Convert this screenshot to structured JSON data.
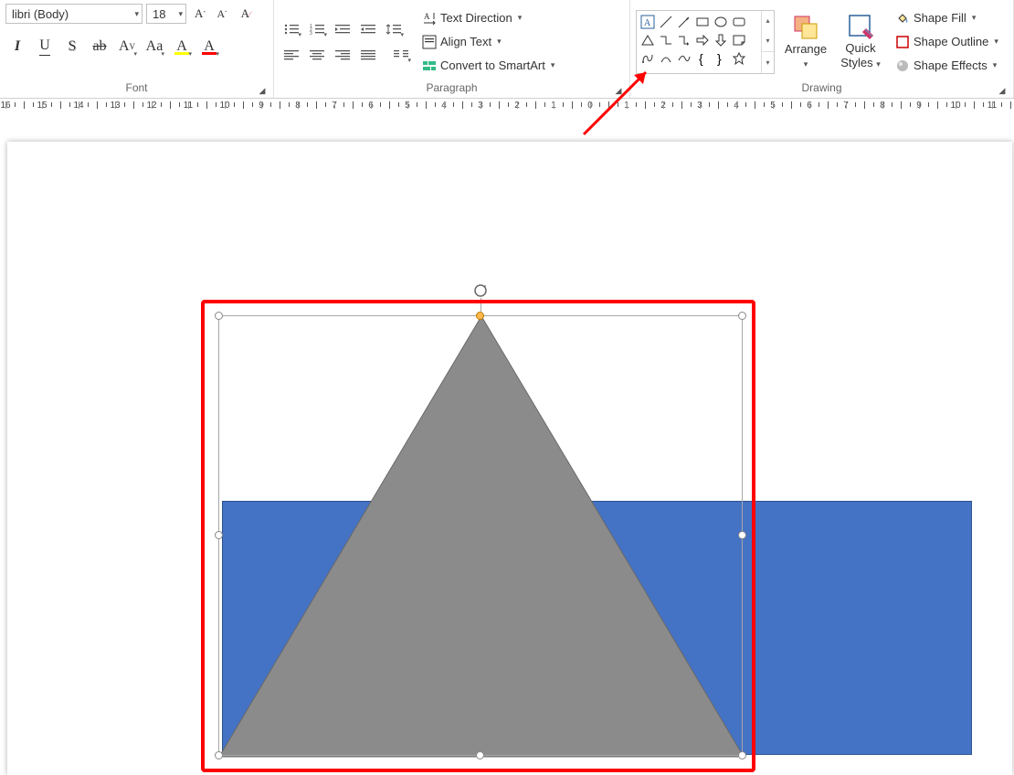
{
  "font": {
    "name": "libri (Body)",
    "size": "18",
    "group_label": "Font"
  },
  "paragraph": {
    "group_label": "Paragraph",
    "text_direction": "Text Direction",
    "align_text": "Align Text",
    "convert_smartart": "Convert to SmartArt"
  },
  "drawing": {
    "group_label": "Drawing",
    "arrange": "Arrange",
    "quick_styles_1": "Quick",
    "quick_styles_2": "Styles",
    "shape_fill": "Shape Fill",
    "shape_outline": "Shape Outline",
    "shape_effects": "Shape Effects"
  },
  "ruler": {
    "labels": [
      "16",
      "15",
      "14",
      "13",
      "12",
      "11",
      "10",
      "9",
      "8",
      "7",
      "6",
      "5",
      "4",
      "3",
      "2",
      "1",
      "0",
      "1",
      "2",
      "3",
      "4",
      "5",
      "6",
      "7",
      "8",
      "9",
      "10",
      "11"
    ]
  },
  "canvas": {
    "blue_rect_color": "#4472c4",
    "triangle_color": "#8b8b8b",
    "highlight_color": "#ff0000"
  }
}
